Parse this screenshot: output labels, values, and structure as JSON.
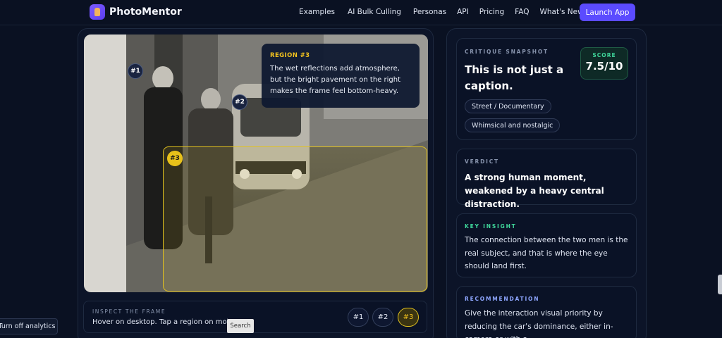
{
  "brand": {
    "name": "PhotoMentor"
  },
  "nav": {
    "links": [
      "Examples",
      "AI Bulk Culling",
      "Personas",
      "API",
      "Pricing",
      "FAQ",
      "What's New"
    ],
    "cta": "Launch App"
  },
  "photo": {
    "markers": [
      "#1",
      "#2",
      "#3"
    ],
    "active_region": "#3",
    "tooltip": {
      "title": "REGION #3",
      "text": "The wet reflections add atmosphere, but the bright pavement on the right makes the frame feel bottom-heavy."
    }
  },
  "inspect": {
    "label": "INSPECT THE FRAME",
    "hint": "Hover on desktop. Tap a region on mobile.",
    "pills": [
      "#1",
      "#2",
      "#3"
    ]
  },
  "snapshot": {
    "eyebrow": "CRITIQUE SNAPSHOT",
    "title": "This is not just a caption.",
    "score_label": "SCORE",
    "score_value": "7.5/10",
    "tags": [
      "Street / Documentary",
      "Whimsical and nostalgic"
    ]
  },
  "verdict": {
    "eyebrow": "VERDICT",
    "text": "A strong human moment, weakened by a heavy central distraction."
  },
  "insight": {
    "eyebrow": "KEY INSIGHT",
    "text": "The connection between the two men is the real subject, and that is where the eye should land first."
  },
  "recommendation": {
    "eyebrow": "RECOMMENDATION",
    "text": "Give the interaction visual priority by reducing the car's dominance, either in-camera or with a"
  },
  "overlays": {
    "search_tooltip": "Search",
    "analytics_button": "Turn off analytics"
  },
  "colors": {
    "accent": "#5b4bff",
    "region_highlight": "#e2c21e",
    "score_green": "#3fd69a",
    "insight_green": "#3fd69a",
    "recommendation_blue": "#8ea6ff"
  }
}
